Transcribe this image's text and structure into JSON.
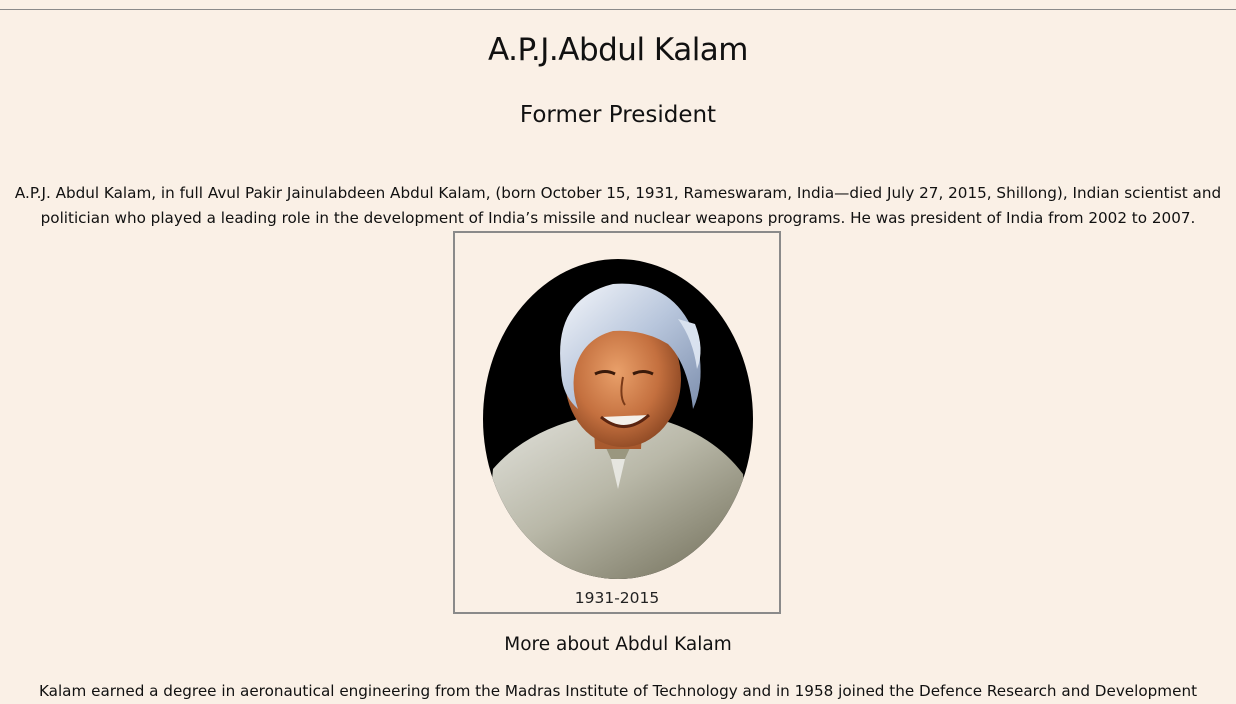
{
  "header": {
    "name": "A.P.J.Abdul Kalam",
    "role": "Former President"
  },
  "intro": {
    "text": "A.P.J. Abdul Kalam, in full Avul Pakir Jainulabdeen Abdul Kalam, (born October 15, 1931, Rameswaram, India—died July 27, 2015, Shillong), Indian scientist and politician who played a leading role in the development of India’s missile and nuclear weapons programs. He was president of India from 2002 to 2007."
  },
  "figure": {
    "image_name": "portrait-abdul-kalam",
    "caption": "1931-2015"
  },
  "more": {
    "heading": "More about Abdul Kalam",
    "text": "Kalam earned a degree in aeronautical engineering from the Madras Institute of Technology and in 1958 joined the Defence Research and Development"
  },
  "colors": {
    "background": "#faf0e6",
    "border": "#8a8a8a"
  }
}
